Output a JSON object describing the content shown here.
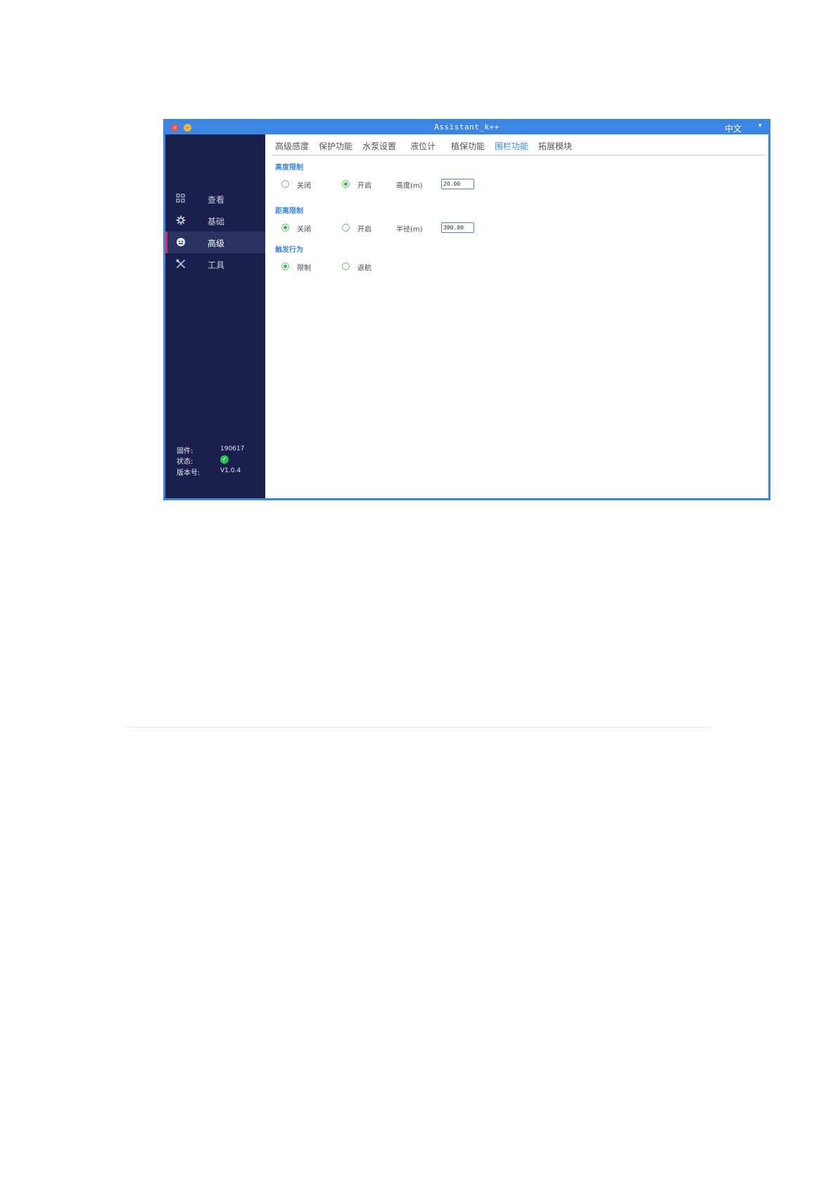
{
  "window": {
    "title": "Assistant_k++",
    "close_glyph": "×",
    "minimize_glyph": "–",
    "language": "中文",
    "language_caret": "▾"
  },
  "sidebar": {
    "items": [
      {
        "label": "查看",
        "icon": "view-grid-icon",
        "active": false
      },
      {
        "label": "基础",
        "icon": "gear-icon",
        "active": false
      },
      {
        "label": "高级",
        "icon": "advanced-icon",
        "active": true
      },
      {
        "label": "工具",
        "icon": "tools-icon",
        "active": false
      }
    ],
    "info": {
      "firmware_label": "固件:",
      "firmware_value": "190617",
      "status_label": "状态:",
      "status_icon": "check-icon",
      "version_label": "版本号:",
      "version_value": "V1.0.4"
    }
  },
  "tabs": [
    {
      "label": "高级感度",
      "active": false
    },
    {
      "label": "保护功能",
      "active": false
    },
    {
      "label": "水泵设置",
      "active": false
    },
    {
      "label": "液位计",
      "active": false
    },
    {
      "label": "植保功能",
      "active": false
    },
    {
      "label": "围栏功能",
      "active": true
    },
    {
      "label": "拓展模块",
      "active": false
    }
  ],
  "sections": {
    "height_limit": {
      "title": "高度限制",
      "off_label": "关闭",
      "on_label": "开启",
      "selected": "on",
      "field_label": "高度(m)",
      "field_value": "20.00"
    },
    "distance_limit": {
      "title": "距离限制",
      "off_label": "关闭",
      "on_label": "开启",
      "selected": "off",
      "field_label": "半径(m)",
      "field_value": "300.00"
    },
    "trigger_action": {
      "title": "触发行为",
      "limit_label": "限制",
      "return_label": "返航",
      "selected": "limit"
    }
  },
  "colors": {
    "accent": "#3d87e4",
    "sidebar_bg": "#1a1f4b",
    "active_marker": "#e0304a",
    "radio_green": "#36b836"
  }
}
